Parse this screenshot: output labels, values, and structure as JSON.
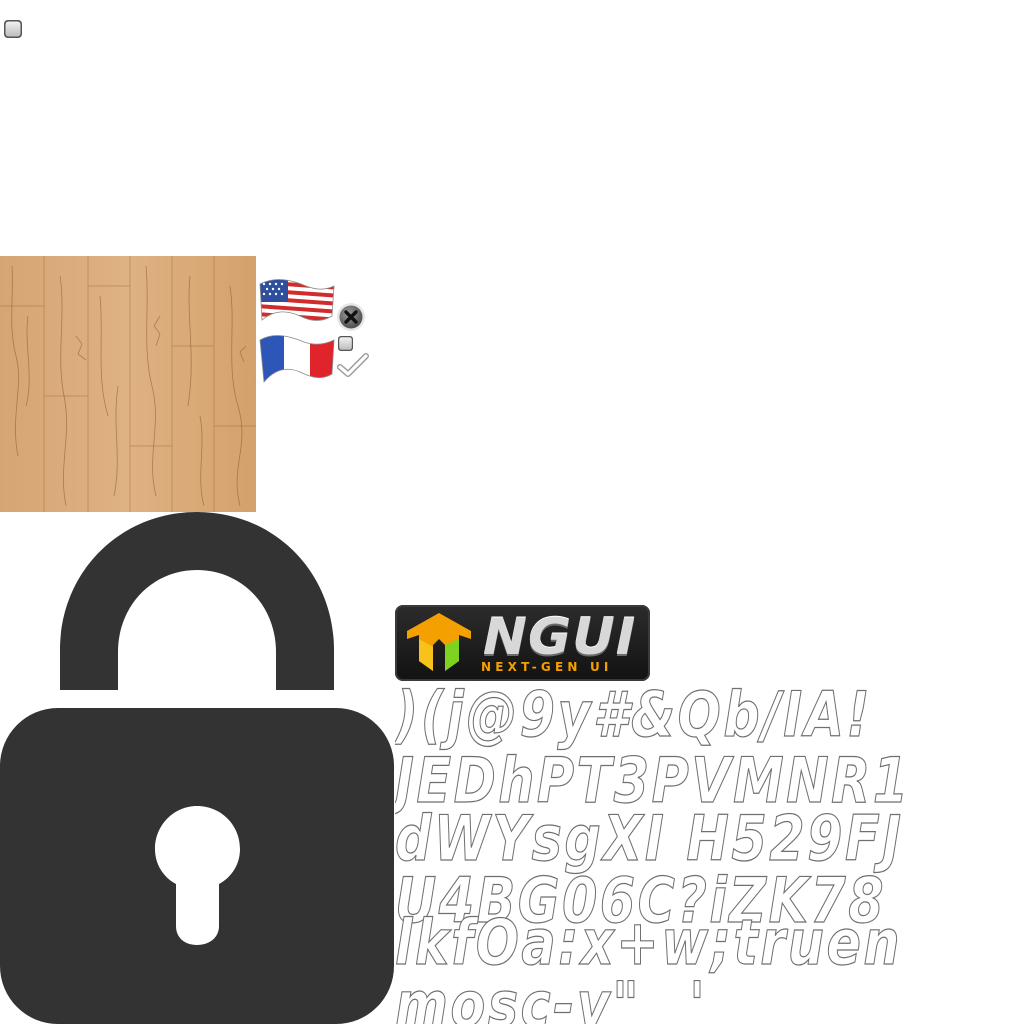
{
  "logo": {
    "word": "NGUI",
    "tagline": "NEXT-GEN UI"
  },
  "glyph_rows": [
    ")(j@9y#&Qb/IA!",
    "JEDhPT3PVMNR1",
    "dWYsgXI H529FJ",
    "U4BG06C?iZK78",
    "lkfOa:x+w;truen",
    "mosc-v\" _' "
  ],
  "colors": {
    "lock": "#333333",
    "logo_accent": "#f4a000",
    "logo_green": "#7ed321",
    "glyph_outline": "#6f6f6f"
  },
  "icons": {
    "checkbox": "checkbox-icon",
    "close": "close-icon",
    "check": "checkmark-icon",
    "lock": "lock-icon",
    "flag_us": "us-flag-icon",
    "flag_fr": "france-flag-icon"
  }
}
